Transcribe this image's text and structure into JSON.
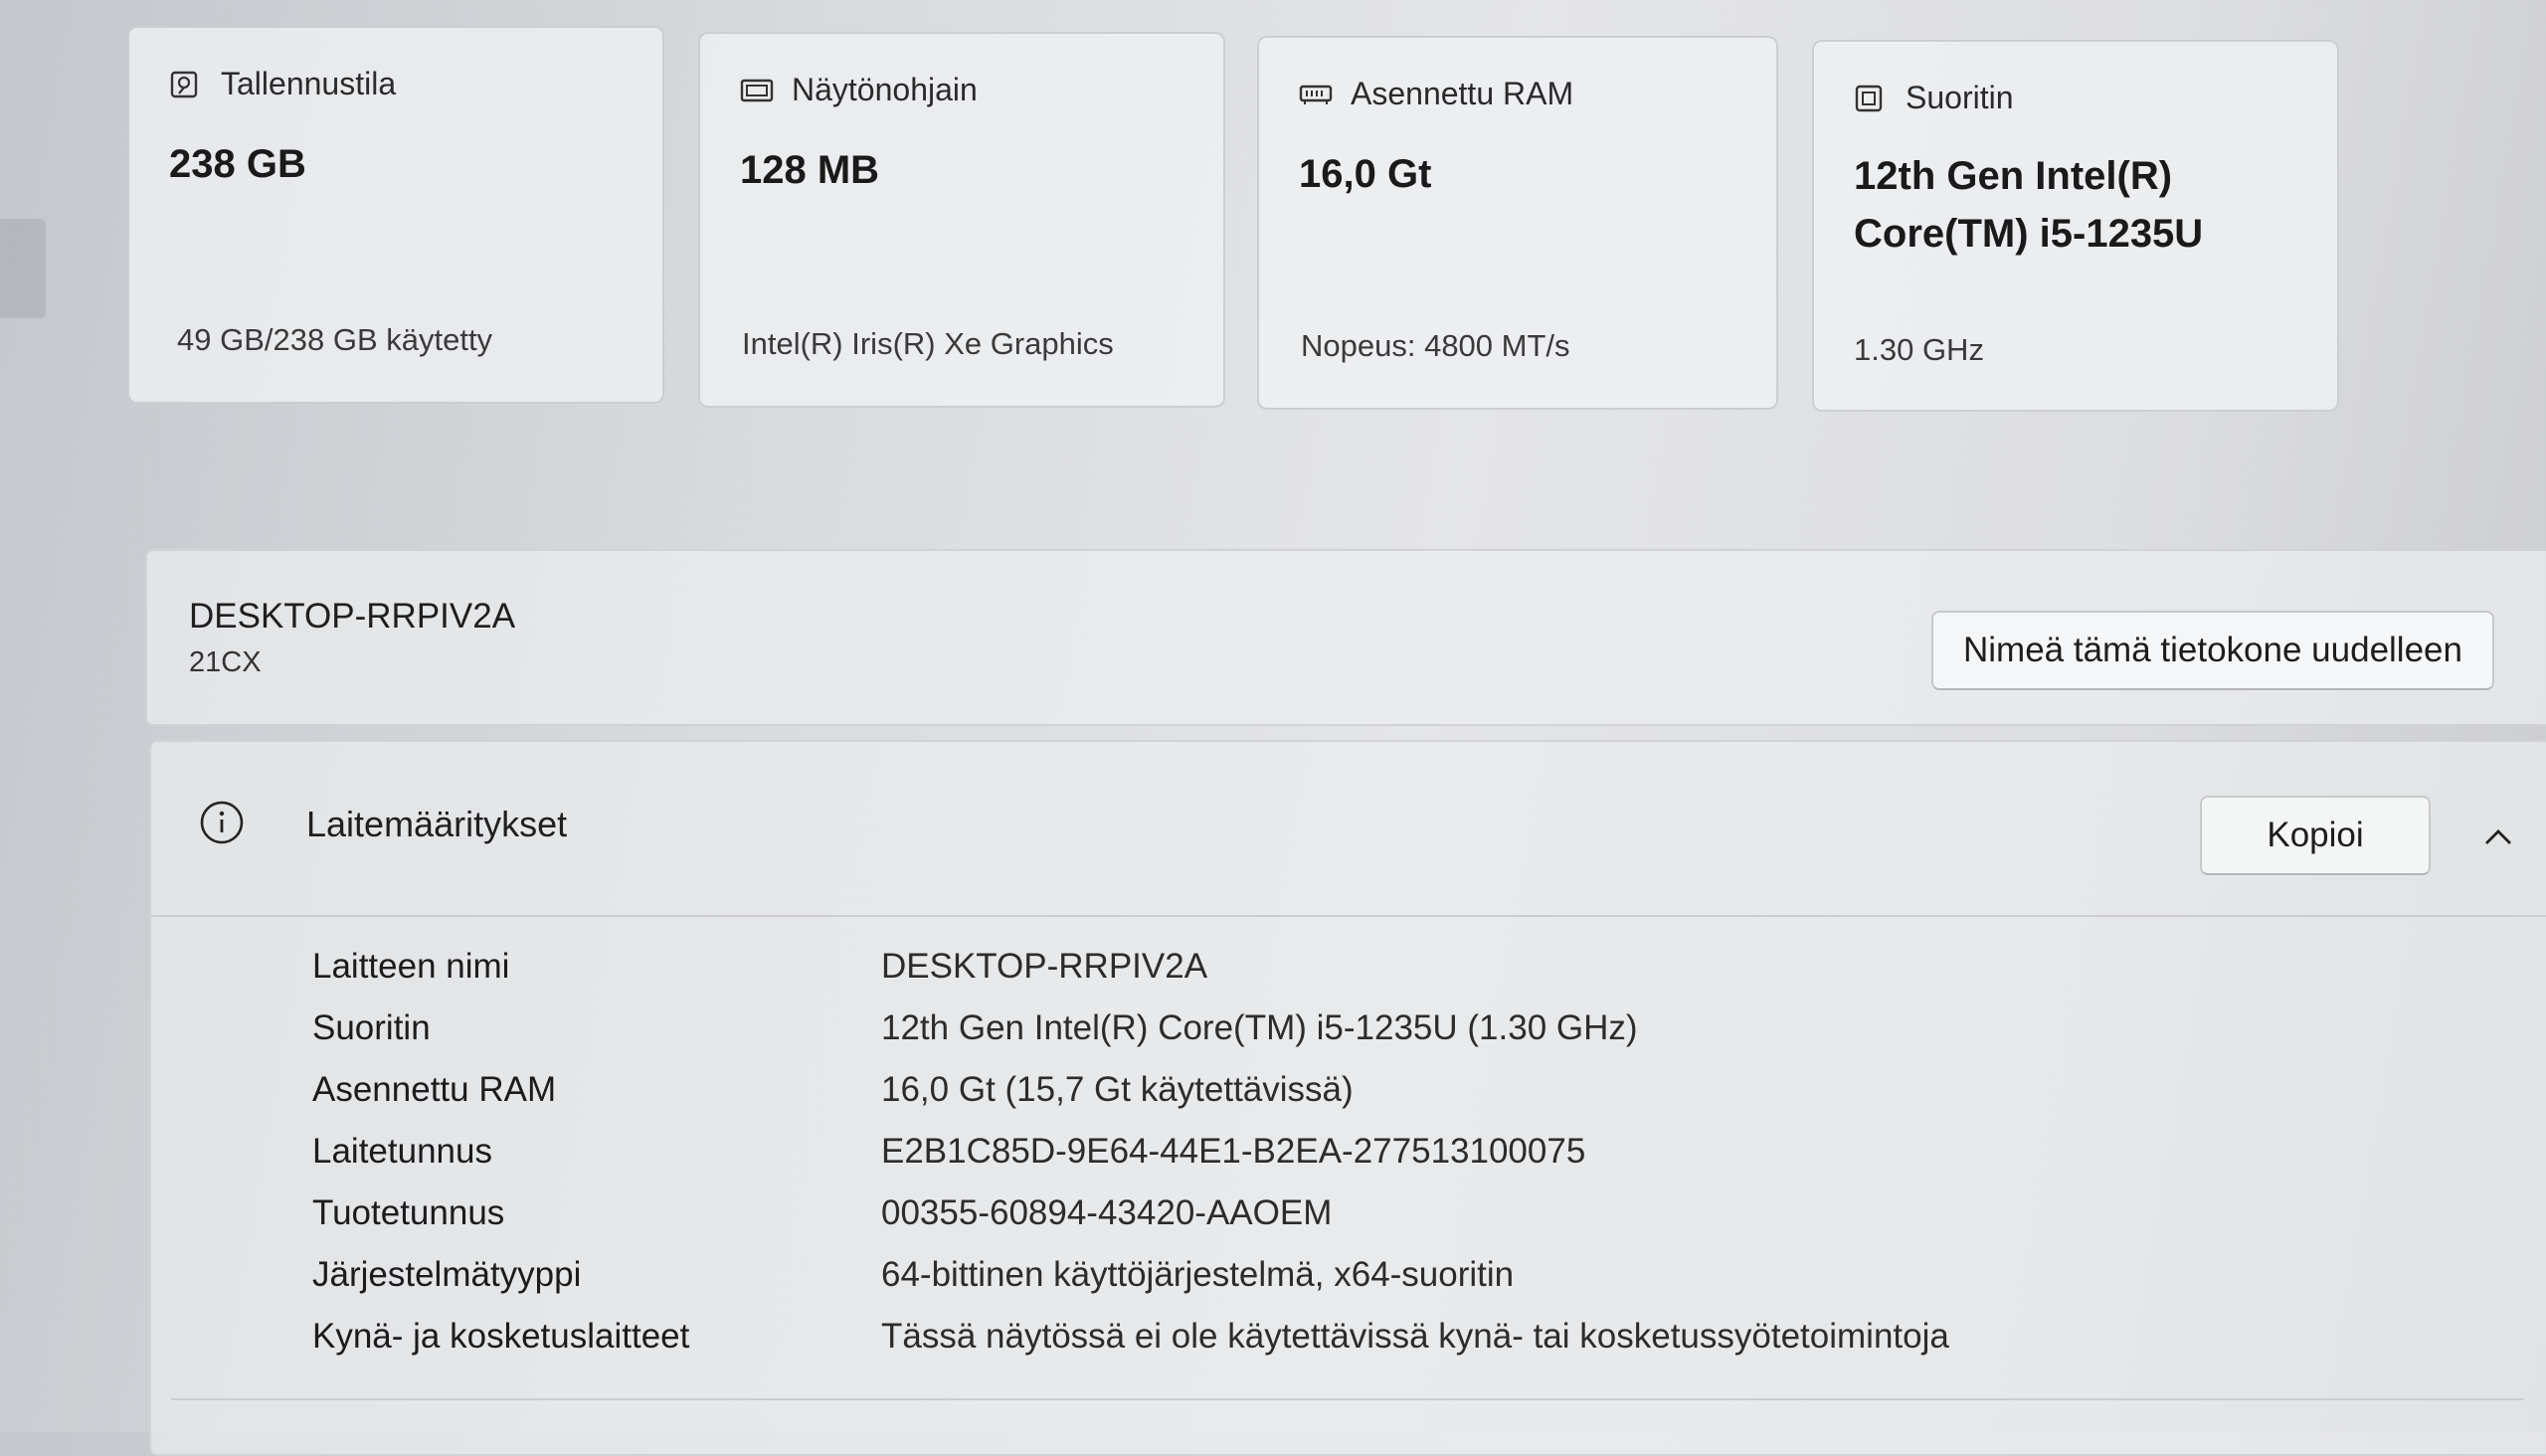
{
  "cards": [
    {
      "icon": "storage-icon",
      "title": "Tallennustila",
      "value": "238 GB",
      "subtitle": "49 GB/238 GB käytetty"
    },
    {
      "icon": "graphics-card-icon",
      "title": "Näytönohjain",
      "value": "128 MB",
      "subtitle": "Intel(R) Iris(R) Xe Graphics"
    },
    {
      "icon": "ram-icon",
      "title": "Asennettu RAM",
      "value": "16,0 Gt",
      "subtitle": "Nopeus: 4800 MT/s"
    },
    {
      "icon": "processor-icon",
      "title": "Suoritin",
      "value_line1": "12th Gen Intel(R)",
      "value_line2": "Core(TM) i5-1235U",
      "subtitle": "1.30 GHz"
    }
  ],
  "device": {
    "name": "DESKTOP-RRPIV2A",
    "model": "21CX",
    "rename_label": "Nimeä tämä tietokone uudelleen"
  },
  "specs": {
    "title": "Laitemääritykset",
    "copy_label": "Kopioi",
    "icon": "info-icon",
    "rows": [
      {
        "label": "Laitteen nimi",
        "value": "DESKTOP-RRPIV2A"
      },
      {
        "label": "Suoritin",
        "value": "12th Gen Intel(R) Core(TM) i5-1235U (1.30 GHz)"
      },
      {
        "label": "Asennettu RAM",
        "value": "16,0 Gt (15,7 Gt käytettävissä)"
      },
      {
        "label": "Laitetunnus",
        "value": "E2B1C85D-9E64-44E1-B2EA-277513100075"
      },
      {
        "label": "Tuotetunnus",
        "value": "00355-60894-43420-AAOEM"
      },
      {
        "label": "Järjestelmätyyppi",
        "value": "64-bittinen käyttöjärjestelmä, x64-suoritin"
      },
      {
        "label": "Kynä- ja kosketuslaitteet",
        "value": "Tässä näytössä ei ole käytettävissä kynä- tai kosketussyötetoimintoja"
      }
    ]
  }
}
